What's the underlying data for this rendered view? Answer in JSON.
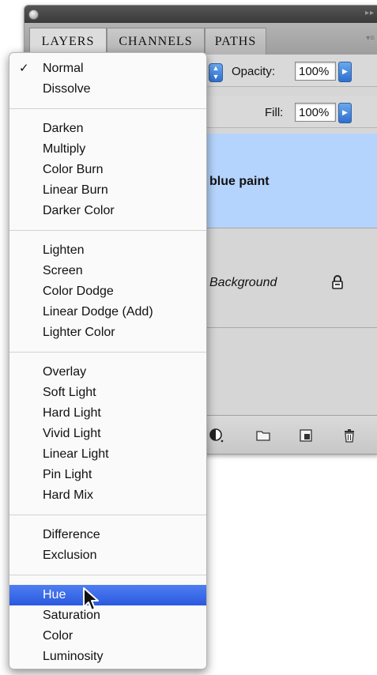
{
  "panel": {
    "tabs": [
      {
        "label": "LAYERS",
        "active": true
      },
      {
        "label": "CHANNELS",
        "active": false
      },
      {
        "label": "PATHS",
        "active": false
      }
    ],
    "opacity_label": "Opacity:",
    "opacity_value": "100%",
    "fill_label": "Fill:",
    "fill_value": "100%",
    "layers": [
      {
        "name": "blue paint",
        "selected": true
      },
      {
        "name": "Background",
        "selected": false,
        "locked": true
      }
    ]
  },
  "blend_menu": {
    "selected_mode": "Normal",
    "hovered_mode": "Hue",
    "groups": [
      [
        "Normal",
        "Dissolve"
      ],
      [
        "Darken",
        "Multiply",
        "Color Burn",
        "Linear Burn",
        "Darker Color"
      ],
      [
        "Lighten",
        "Screen",
        "Color Dodge",
        "Linear Dodge (Add)",
        "Lighter Color"
      ],
      [
        "Overlay",
        "Soft Light",
        "Hard Light",
        "Vivid Light",
        "Linear Light",
        "Pin Light",
        "Hard Mix"
      ],
      [
        "Difference",
        "Exclusion"
      ],
      [
        "Hue",
        "Saturation",
        "Color",
        "Luminosity"
      ]
    ],
    "check_glyph": "✓"
  },
  "icons": {
    "close": "close-icon",
    "lock": "lock-icon",
    "adjustment": "adjustment-layer-icon",
    "folder": "new-group-icon",
    "new_layer": "new-layer-icon",
    "trash": "trash-icon",
    "cursor": "mouse-pointer-icon"
  },
  "colors": {
    "selection_highlight": "#2a59df",
    "selected_layer": "#b5d4fd"
  }
}
